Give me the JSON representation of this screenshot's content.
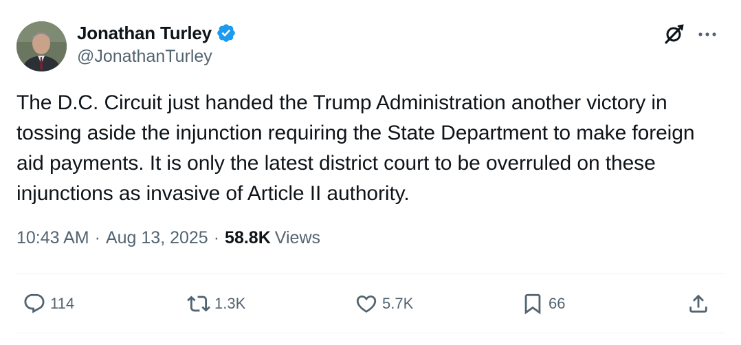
{
  "author": {
    "display_name": "Jonathan Turley",
    "handle": "@JonathanTurley",
    "verified": true
  },
  "tweet": {
    "text": "The D.C. Circuit just handed the Trump Administration another victory in tossing aside the injunction requiring the State Department to make foreign aid payments. It is only the latest district court to be overruled on these injunctions as invasive of Article II authority."
  },
  "meta": {
    "time": "10:43 AM",
    "separator": "·",
    "date": "Aug 13, 2025",
    "views_count": "58.8K",
    "views_label": "Views"
  },
  "actions": {
    "replies": "114",
    "reposts": "1.3K",
    "likes": "5.7K",
    "bookmarks": "66"
  },
  "icons": {
    "header": [
      "grok-icon",
      "more-icon"
    ],
    "actions": [
      "reply-icon",
      "repost-icon",
      "like-icon",
      "bookmark-icon",
      "share-icon"
    ]
  },
  "colors": {
    "text_primary": "#0f1419",
    "text_secondary": "#536471",
    "verified_badge": "#1d9bf0",
    "divider": "#eff3f4"
  }
}
